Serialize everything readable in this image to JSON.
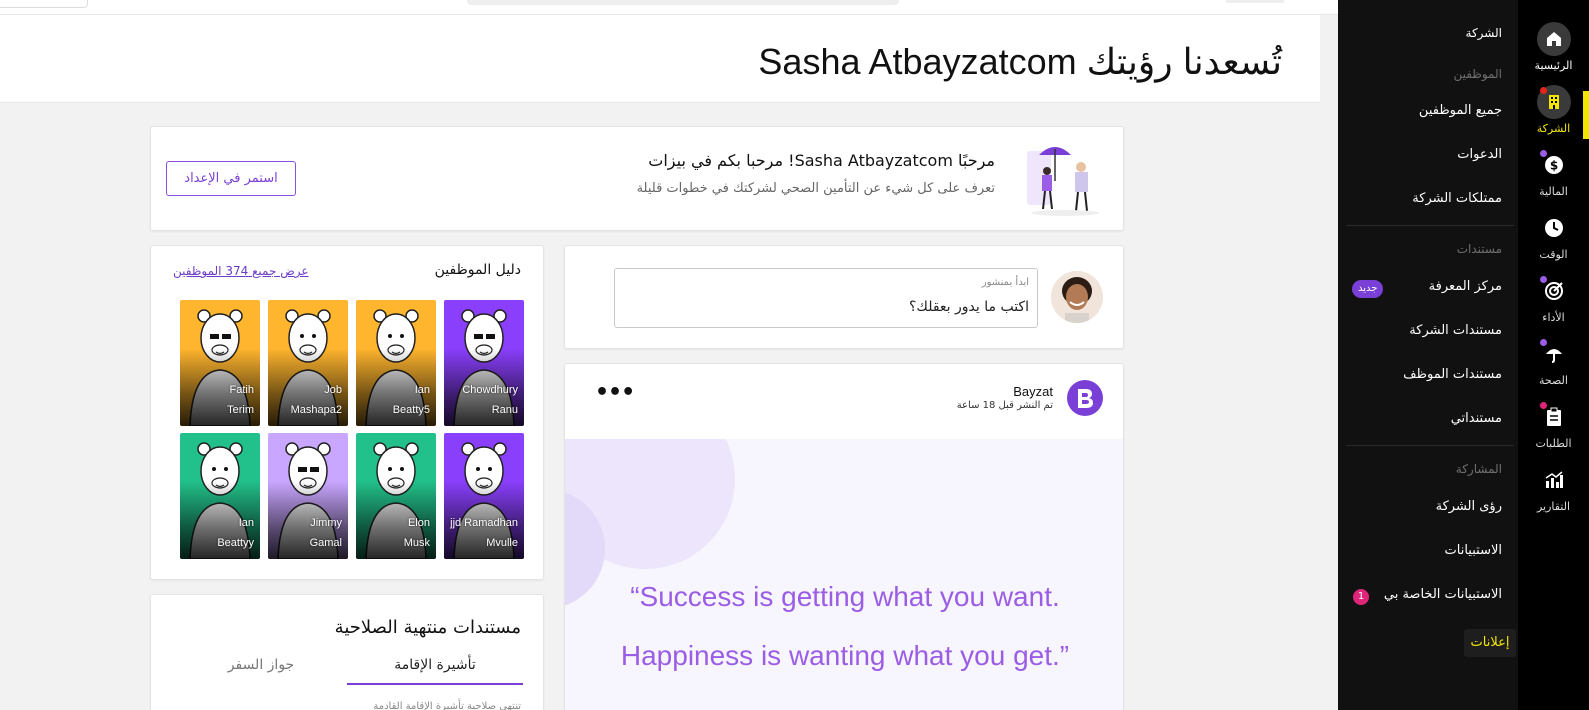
{
  "header": {
    "title": "تُسعدنا رؤيتك Sasha Atbayzatcom"
  },
  "welcome": {
    "title": "مرحبًا Sasha Atbayzatcom! مرحبا بكم في بيزات",
    "subtitle": "تعرف على كل شيء عن التأمين الصحي لشركتك في خطوات قليلة",
    "button": "استمر في الإعداد"
  },
  "directory": {
    "title": "دليل الموظفين",
    "view_all": "عرض جميع 374 الموظفين",
    "employees": [
      {
        "first": "Chowdhury",
        "last": "Ranu",
        "color": "#8a3ffc"
      },
      {
        "first": "Ian",
        "last": "Beatty5",
        "color": "#ffb52e"
      },
      {
        "first": "Job",
        "last": "Mashapa2",
        "color": "#ffb52e"
      },
      {
        "first": "Fatih",
        "last": "Terim",
        "color": "#ffb52e"
      },
      {
        "first": "jjd Ramadhan",
        "last": "Mvulle",
        "color": "#8a3ffc"
      },
      {
        "first": "Elon",
        "last": "Musk",
        "color": "#22c08a"
      },
      {
        "first": "Jimmy",
        "last": "Gamal",
        "color": "#c9a6ff"
      },
      {
        "first": "Ian",
        "last": "Beattyy",
        "color": "#22c08a"
      }
    ]
  },
  "documents": {
    "title": "مستندات منتهية الصلاحية",
    "tabs": [
      "تأشيرة الإقامة",
      "جواز السفر"
    ],
    "active_tab": "تأشيرة الإقامة",
    "clipped_text": "تنتهي صلاحية تأشيرة الإقامة القادمة"
  },
  "composer": {
    "label": "ابدأ بمنشور",
    "value": "اكتب ما يدور بعقلك؟"
  },
  "post": {
    "author": "Bayzat",
    "time": "تم النشر قبل 18 ساعة",
    "menu": "•••",
    "quote_line1": "“Success is getting what you want.",
    "quote_line2": "Happiness is wanting what you get.”"
  },
  "sidebar": {
    "company_header": "الشركة",
    "sections": {
      "employees": "الموظفين",
      "documents": "مستندات",
      "engagement": "المشاركة"
    },
    "items": {
      "all_employees": "جميع الموظفين",
      "invitations": "الدعوات",
      "company_assets": "ممتلكات الشركة",
      "knowledge_center": "مركز المعرفة",
      "company_docs": "مستندات الشركة",
      "employee_docs": "مستندات الموظف",
      "my_docs": "مستنداتي",
      "company_insights": "رؤى الشركة",
      "surveys": "الاستبيانات",
      "my_surveys": "الاستبيانات الخاصة بي",
      "announcements": "إعلانات"
    },
    "new_badge": "جديد",
    "my_surveys_count": "1"
  },
  "rail": [
    {
      "label": "الرئيسية",
      "icon": "home-icon"
    },
    {
      "label": "الشركة",
      "icon": "building-icon"
    },
    {
      "label": "المالية",
      "icon": "dollar-icon"
    },
    {
      "label": "الوقت",
      "icon": "clock-icon"
    },
    {
      "label": "الأداء",
      "icon": "target-icon"
    },
    {
      "label": "الصحة",
      "icon": "umbrella-icon"
    },
    {
      "label": "الطلبات",
      "icon": "clipboard-icon"
    },
    {
      "label": "التقارير",
      "icon": "chart-icon"
    }
  ],
  "colors": {
    "accent_purple": "#7a3fd6",
    "accent_yellow": "#f2e600",
    "notification_red": "#e8231b",
    "badge_pink": "#e0247a"
  }
}
